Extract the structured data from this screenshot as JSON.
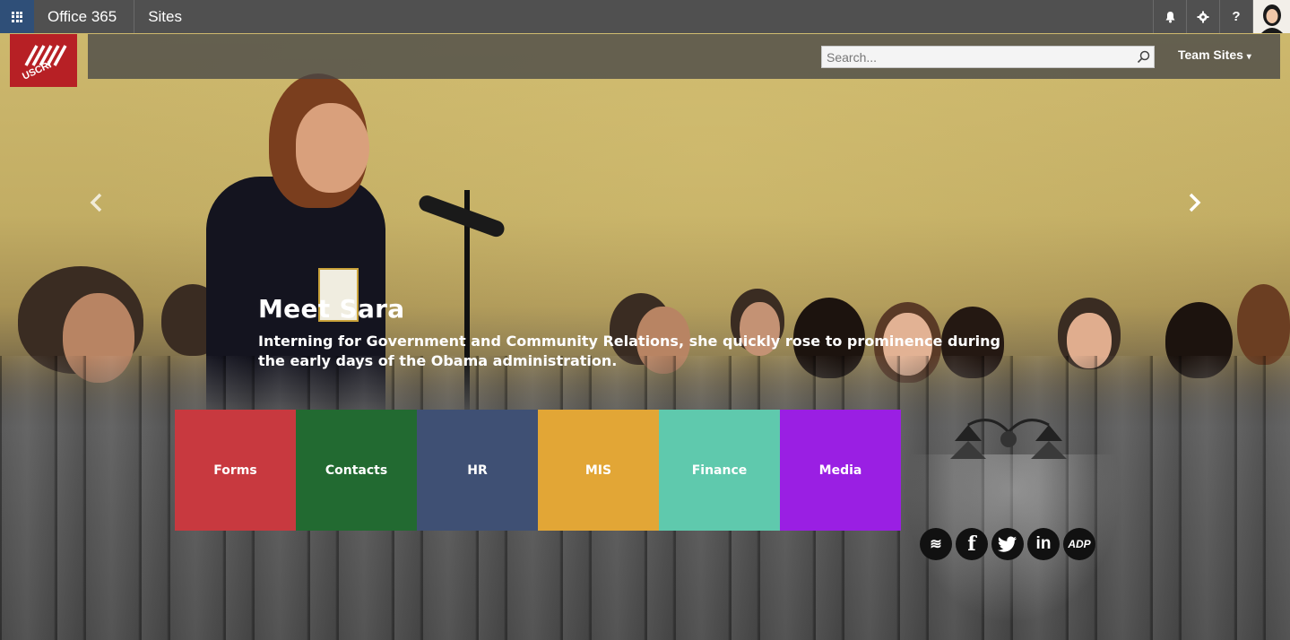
{
  "suite_bar": {
    "brand": "Office 365",
    "app_name": "Sites",
    "notifications_label": "",
    "settings_label": "",
    "help_label": "?"
  },
  "site": {
    "logo_text": "USCRI",
    "search": {
      "placeholder": "Search...",
      "value": ""
    },
    "team_sites_label": "Team Sites",
    "team_sites_caret": "▾"
  },
  "carousel": {
    "prev_icon": "chevron-left-icon",
    "next_icon": "chevron-right-icon",
    "title": "Meet Sara",
    "text": "Interning for Government and Community Relations, she quickly rose to prominence during the early days of the Obama administration."
  },
  "tiles": [
    {
      "label": "Forms",
      "color": "#c8393f"
    },
    {
      "label": "Contacts",
      "color": "#226a31"
    },
    {
      "label": "HR",
      "color": "#3f5074"
    },
    {
      "label": "MIS",
      "color": "#e2a636"
    },
    {
      "label": "Finance",
      "color": "#5fc9ad"
    },
    {
      "label": "Media",
      "color": "#9a1fe3"
    }
  ],
  "social": [
    {
      "name": "uscri-icon",
      "glyph": "≋"
    },
    {
      "name": "facebook-icon",
      "glyph": "f"
    },
    {
      "name": "twitter-icon",
      "glyph": "🐦"
    },
    {
      "name": "linkedin-icon",
      "glyph": "in"
    },
    {
      "name": "adp-icon",
      "glyph": "ADP"
    }
  ],
  "colors": {
    "suite_bar": "#505050",
    "waffle": "#2f4f78",
    "logo": "#b72025"
  }
}
